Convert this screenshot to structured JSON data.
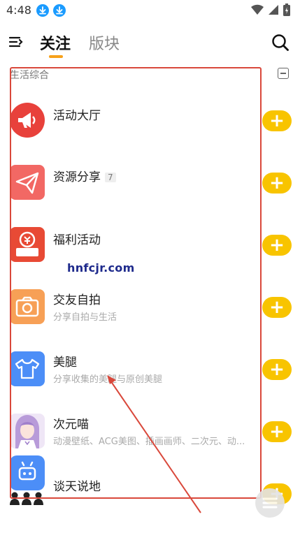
{
  "status_bar": {
    "time": "4:48"
  },
  "header": {
    "tab_follow": "关注",
    "tab_board": "版块"
  },
  "section": {
    "title": "生活综合"
  },
  "items": [
    {
      "name": "活动大厅",
      "badge": "",
      "desc": ""
    },
    {
      "name": "资源分享",
      "badge": "7",
      "desc": ""
    },
    {
      "name": "福利活动",
      "badge": "",
      "desc": ""
    },
    {
      "name": "交友自拍",
      "badge": "",
      "desc": "分享自拍与生活"
    },
    {
      "name": "美腿",
      "badge": "",
      "desc": "分享收集的美腿与原创美腿"
    },
    {
      "name": "次元喵",
      "badge": "",
      "desc": "动漫壁纸、ACG美图、插画画师、二次元、动..."
    },
    {
      "name": "谈天说地",
      "badge": "",
      "desc": ""
    }
  ],
  "follow_label": "+",
  "watermark": "hnfcjr.com",
  "colors": {
    "accent_yellow": "#f8c400",
    "tab_underline": "#f7a11a",
    "annotation_red": "#d9483b",
    "download_blue": "#1a9bff"
  }
}
